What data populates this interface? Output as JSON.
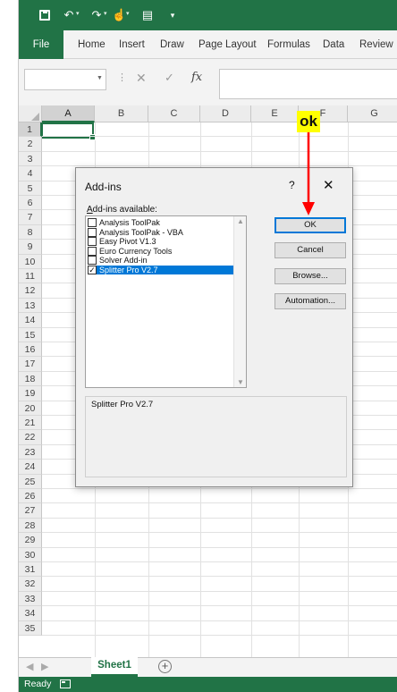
{
  "quick_access": {
    "icons": [
      "save-icon",
      "undo-icon",
      "redo-icon",
      "touch-mode-icon",
      "form-icon",
      "customize-icon"
    ],
    "undo_glyph": "↶",
    "redo_glyph": "↷",
    "touch_glyph": "☝",
    "form_glyph": "▤",
    "more_glyph": "▾",
    "dd_glyph": "▾"
  },
  "ribbon": {
    "tabs": [
      "File",
      "Home",
      "Insert",
      "Draw",
      "Page Layout",
      "Formulas",
      "Data",
      "Review"
    ]
  },
  "formula_bar": {
    "name_box_value": "",
    "separator": "⋮",
    "cancel_glyph": "✕",
    "enter_glyph": "✓",
    "fx_label": "fx",
    "formula_value": ""
  },
  "sheet": {
    "columns": [
      "A",
      "B",
      "C",
      "D",
      "E",
      "F",
      "G"
    ],
    "rows": [
      "1",
      "2",
      "3",
      "4",
      "5",
      "6",
      "7",
      "8",
      "9",
      "10",
      "11",
      "12",
      "13",
      "14",
      "15",
      "16",
      "17",
      "18",
      "19",
      "20",
      "21",
      "22",
      "23",
      "24",
      "25",
      "26",
      "27",
      "28",
      "29",
      "30",
      "31",
      "32",
      "33",
      "34",
      "35"
    ],
    "active_cell": "A1"
  },
  "sheet_tabs": {
    "prev_glyph": "◀",
    "next_glyph": "▶",
    "tabs": [
      "Sheet1"
    ],
    "add_glyph": "+"
  },
  "status_bar": {
    "status_text": "Ready"
  },
  "dialog": {
    "title": "Add-ins",
    "help": "?",
    "close": "✕",
    "available_label_u": "A",
    "available_label_rest": "dd-ins available:",
    "items": [
      {
        "label": "Analysis ToolPak",
        "checked": false
      },
      {
        "label": "Analysis ToolPak - VBA",
        "checked": false
      },
      {
        "label": "Easy Pivot V1.3",
        "checked": false
      },
      {
        "label": "Euro Currency Tools",
        "checked": false
      },
      {
        "label": "Solver Add-in",
        "checked": false
      },
      {
        "label": "Splitter Pro  V2.7",
        "checked": true
      }
    ],
    "selected_index": 5,
    "check_glyph": "✓",
    "scroll_up": "▲",
    "scroll_down": "▼",
    "description": "Splitter Pro  V2.7",
    "buttons": {
      "ok": "OK",
      "cancel": "Cancel",
      "browse": "Browse...",
      "automation": "Automation..."
    }
  },
  "annotation": {
    "text": "ok",
    "color": "#ff0000",
    "highlight": "#ffff00"
  },
  "colors": {
    "excel_green": "#217346",
    "selection_blue": "#0078d7"
  }
}
